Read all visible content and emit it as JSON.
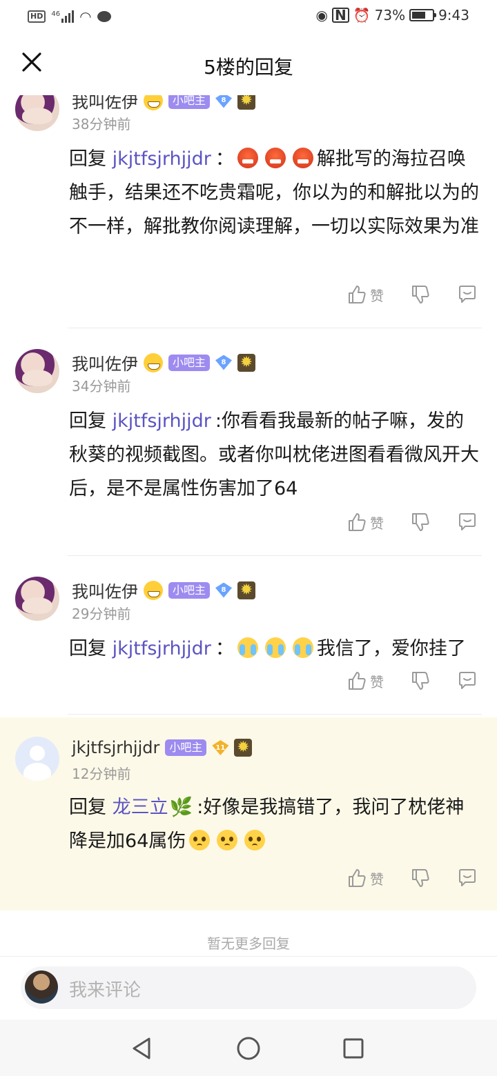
{
  "status_bar": {
    "hd": "HD",
    "signal": "46",
    "battery_percent": "73%",
    "battery_level": 0.73,
    "time": "9:43"
  },
  "header": {
    "title": "5楼的回复",
    "close_icon": "close-icon"
  },
  "replies": [
    {
      "username": "我叫佐伊",
      "owner_badge": "小吧主",
      "level": "8",
      "time": "38分钟前",
      "reply_prefix": "回复",
      "reply_to": "jkjtfsjrhjjdr",
      "separator": "：",
      "text": "解批写的海拉召唤触手，结果还不吃贵霜呢，你以为的和解批以为的不一样，解批教你阅读理解，一切以实际效果为准",
      "like_label": "赞"
    },
    {
      "username": "我叫佐伊",
      "owner_badge": "小吧主",
      "level": "8",
      "time": "34分钟前",
      "reply_prefix": "回复",
      "reply_to": "jkjtfsjrhjjdr",
      "separator": ":",
      "text": "你看看我最新的帖子嘛，发的秋葵的视频截图。或者你叫枕佬进图看看微风开大后，是不是属性伤害加了64",
      "like_label": "赞"
    },
    {
      "username": "我叫佐伊",
      "owner_badge": "小吧主",
      "level": "8",
      "time": "29分钟前",
      "reply_prefix": "回复",
      "reply_to": "jkjtfsjrhjjdr",
      "separator": "：",
      "text": "我信了，爱你挂了",
      "like_label": "赞"
    },
    {
      "username": "jkjtfsjrhjjdr",
      "owner_badge": "小吧主",
      "level": "11",
      "time": "12分钟前",
      "reply_prefix": "回复",
      "reply_to": "龙三立",
      "separator": ":",
      "text": "好像是我搞错了，我问了枕佬神降是加64属伤",
      "like_label": "赞"
    }
  ],
  "footer": {
    "no_more": "暂无更多回复",
    "input_placeholder": "我来评论"
  }
}
